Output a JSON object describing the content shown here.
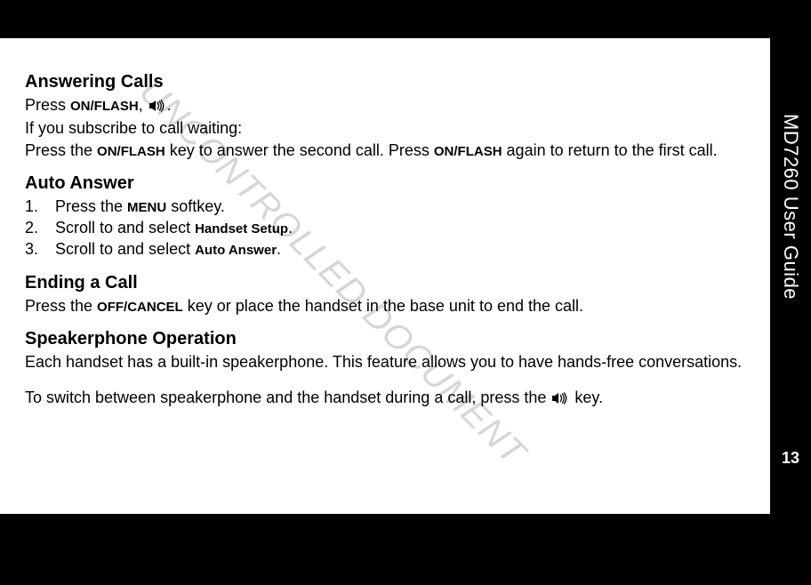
{
  "document_title": "MD7260 User Guide",
  "page_number": "13",
  "watermark": "UNCONTROLLED DOCUMENT",
  "sections": {
    "answering_calls": {
      "heading": "Answering Calls",
      "line1_a": "Press ",
      "key1": "ON/FLASH",
      "line1_b": ", ",
      "line1_c": ".",
      "line2": "If you subscribe to call waiting:",
      "line3_a": "Press the ",
      "key2": "ON/FLASH",
      "line3_b": " key to answer the second call. Press ",
      "key3": "ON/FLASH",
      "line3_c": " again to return to the first call."
    },
    "auto_answer": {
      "heading": "Auto Answer",
      "steps": [
        {
          "a": "Press the ",
          "key": "MENU",
          "b": " softkey."
        },
        {
          "a": "Scroll to and select ",
          "key": "Handset Setup",
          "b": "."
        },
        {
          "a": "Scroll to and select ",
          "key": "Auto Answer",
          "b": "."
        }
      ]
    },
    "ending_call": {
      "heading": "Ending a Call",
      "line_a": "Press the ",
      "key": "OFF/CANCEL",
      "line_b": " key or place the handset in the base unit to end the call."
    },
    "speakerphone": {
      "heading": "Speakerphone Operation",
      "para1": "Each handset has a built-in speakerphone. This feature allows you to have hands-free conversations.",
      "para2_a": "To switch between speakerphone and the handset during a call, press the ",
      "para2_b": " key."
    }
  }
}
